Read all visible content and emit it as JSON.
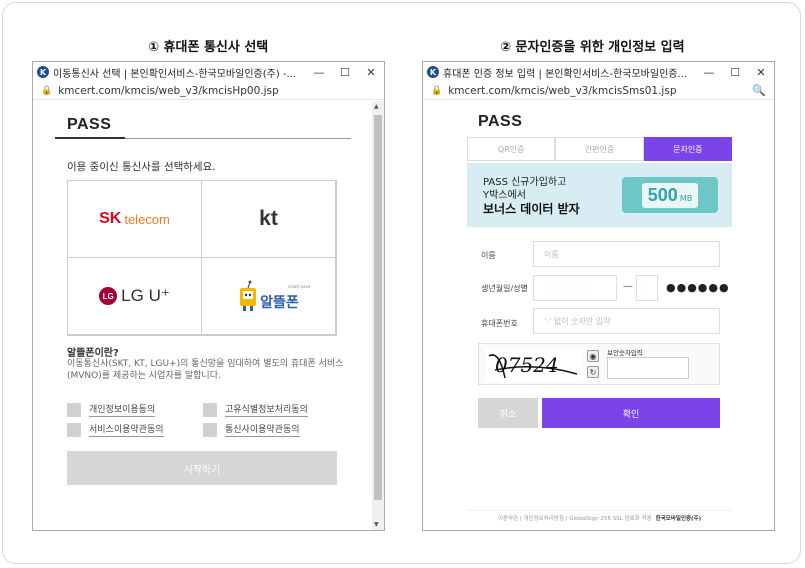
{
  "captions": {
    "left": "① 휴대폰 통신사 선택",
    "right": "② 문자인증을 위한 개인정보 입력"
  },
  "window1": {
    "title": "이동통신사 선택 | 본인확인서비스-한국모바일인증(주) -...",
    "url": "kmcert.com/kmcis/web_v3/kmcisHp00.jsp",
    "logo": "PASS",
    "prompt": "이용 중이신 통신사를 선택하세요.",
    "carriers": {
      "sk_mark": "SK",
      "sk_text": "telecom",
      "kt": "kt",
      "lgu": "LG U⁺",
      "lg_mark": "LG",
      "altteul": "알뜰폰",
      "altteul_tag": "smart save"
    },
    "info_title": "알뜰폰이란?",
    "info_body": "이동통신사(SKT, KT, LGU+)의 통신망을 임대하여 별도의 휴대폰 서비스(MVNO)를 제공하는 사업자를 말합니다.",
    "agreements": [
      "개인정보이용동의",
      "고유식별정보처리동의",
      "서비스이용약관동의",
      "통신사이용약관동의"
    ],
    "start_button": "시작하기"
  },
  "window2": {
    "title": "휴대폰 인증 정보 입력 | 본인확인서비스-한국모바일인증...",
    "url": "kmcert.com/kmcis/web_v3/kmcisSms01.jsp",
    "logo": "PASS",
    "tabs": [
      "QR인증",
      "간편인증",
      "문자인증"
    ],
    "active_tab": "문자인증",
    "banner": {
      "line1": "PASS 신규가입하고",
      "line2": "Y박스에서",
      "line3": "보너스 데이터 받자",
      "amount": "500",
      "unit": "MB"
    },
    "form": {
      "name_label": "이름",
      "name_placeholder": "이름",
      "birth_label": "생년월일/성별",
      "birth_placeholder": "· · · · · ·",
      "gender_placeholder": "·",
      "masked": "●●●●●●",
      "phone_label": "휴대폰번호",
      "phone_placeholder": "'-' 없이 숫자만 입력",
      "captcha_text": "07524",
      "captcha_label": "보안숫자입력"
    },
    "cancel_button": "취소",
    "ok_button": "확인",
    "footer": {
      "links": "이용약관 | 개인정보처리방침 | GlobalSign 256 SSL 암호화 적용",
      "brand": "한국모바일인증(주)"
    }
  },
  "window_controls": [
    "—",
    "☐",
    "✕"
  ],
  "colors": {
    "accent": "#7a44e8",
    "disabled": "#d6d6d6",
    "banner_bg": "#d8ecf3"
  }
}
